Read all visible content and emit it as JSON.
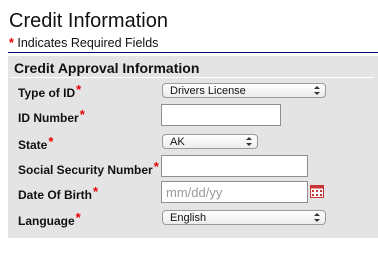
{
  "header": {
    "title": "Credit Information",
    "required_asterisk": "*",
    "required_note": " Indicates Required Fields"
  },
  "panel": {
    "title": "Credit Approval Information",
    "fields": {
      "type_of_id": {
        "label": "Type of ID",
        "asterisk": "*",
        "value": "Drivers License"
      },
      "id_number": {
        "label": "ID Number",
        "asterisk": "*",
        "value": ""
      },
      "state": {
        "label": "State",
        "asterisk": "*",
        "value": "AK"
      },
      "ssn": {
        "label": "Social Security Number",
        "asterisk": "*",
        "value": ""
      },
      "dob": {
        "label": "Date Of Birth",
        "asterisk": "*",
        "value": "",
        "placeholder": "mm/dd/yy"
      },
      "language": {
        "label": "Language",
        "asterisk": "*",
        "value": "English"
      }
    }
  },
  "colors": {
    "required": "#e60000",
    "panel_bg": "#e4e4e4",
    "rule": "#000066"
  },
  "icons": {
    "calendar": "calendar-icon",
    "select_arrows": "select-arrows-icon"
  }
}
